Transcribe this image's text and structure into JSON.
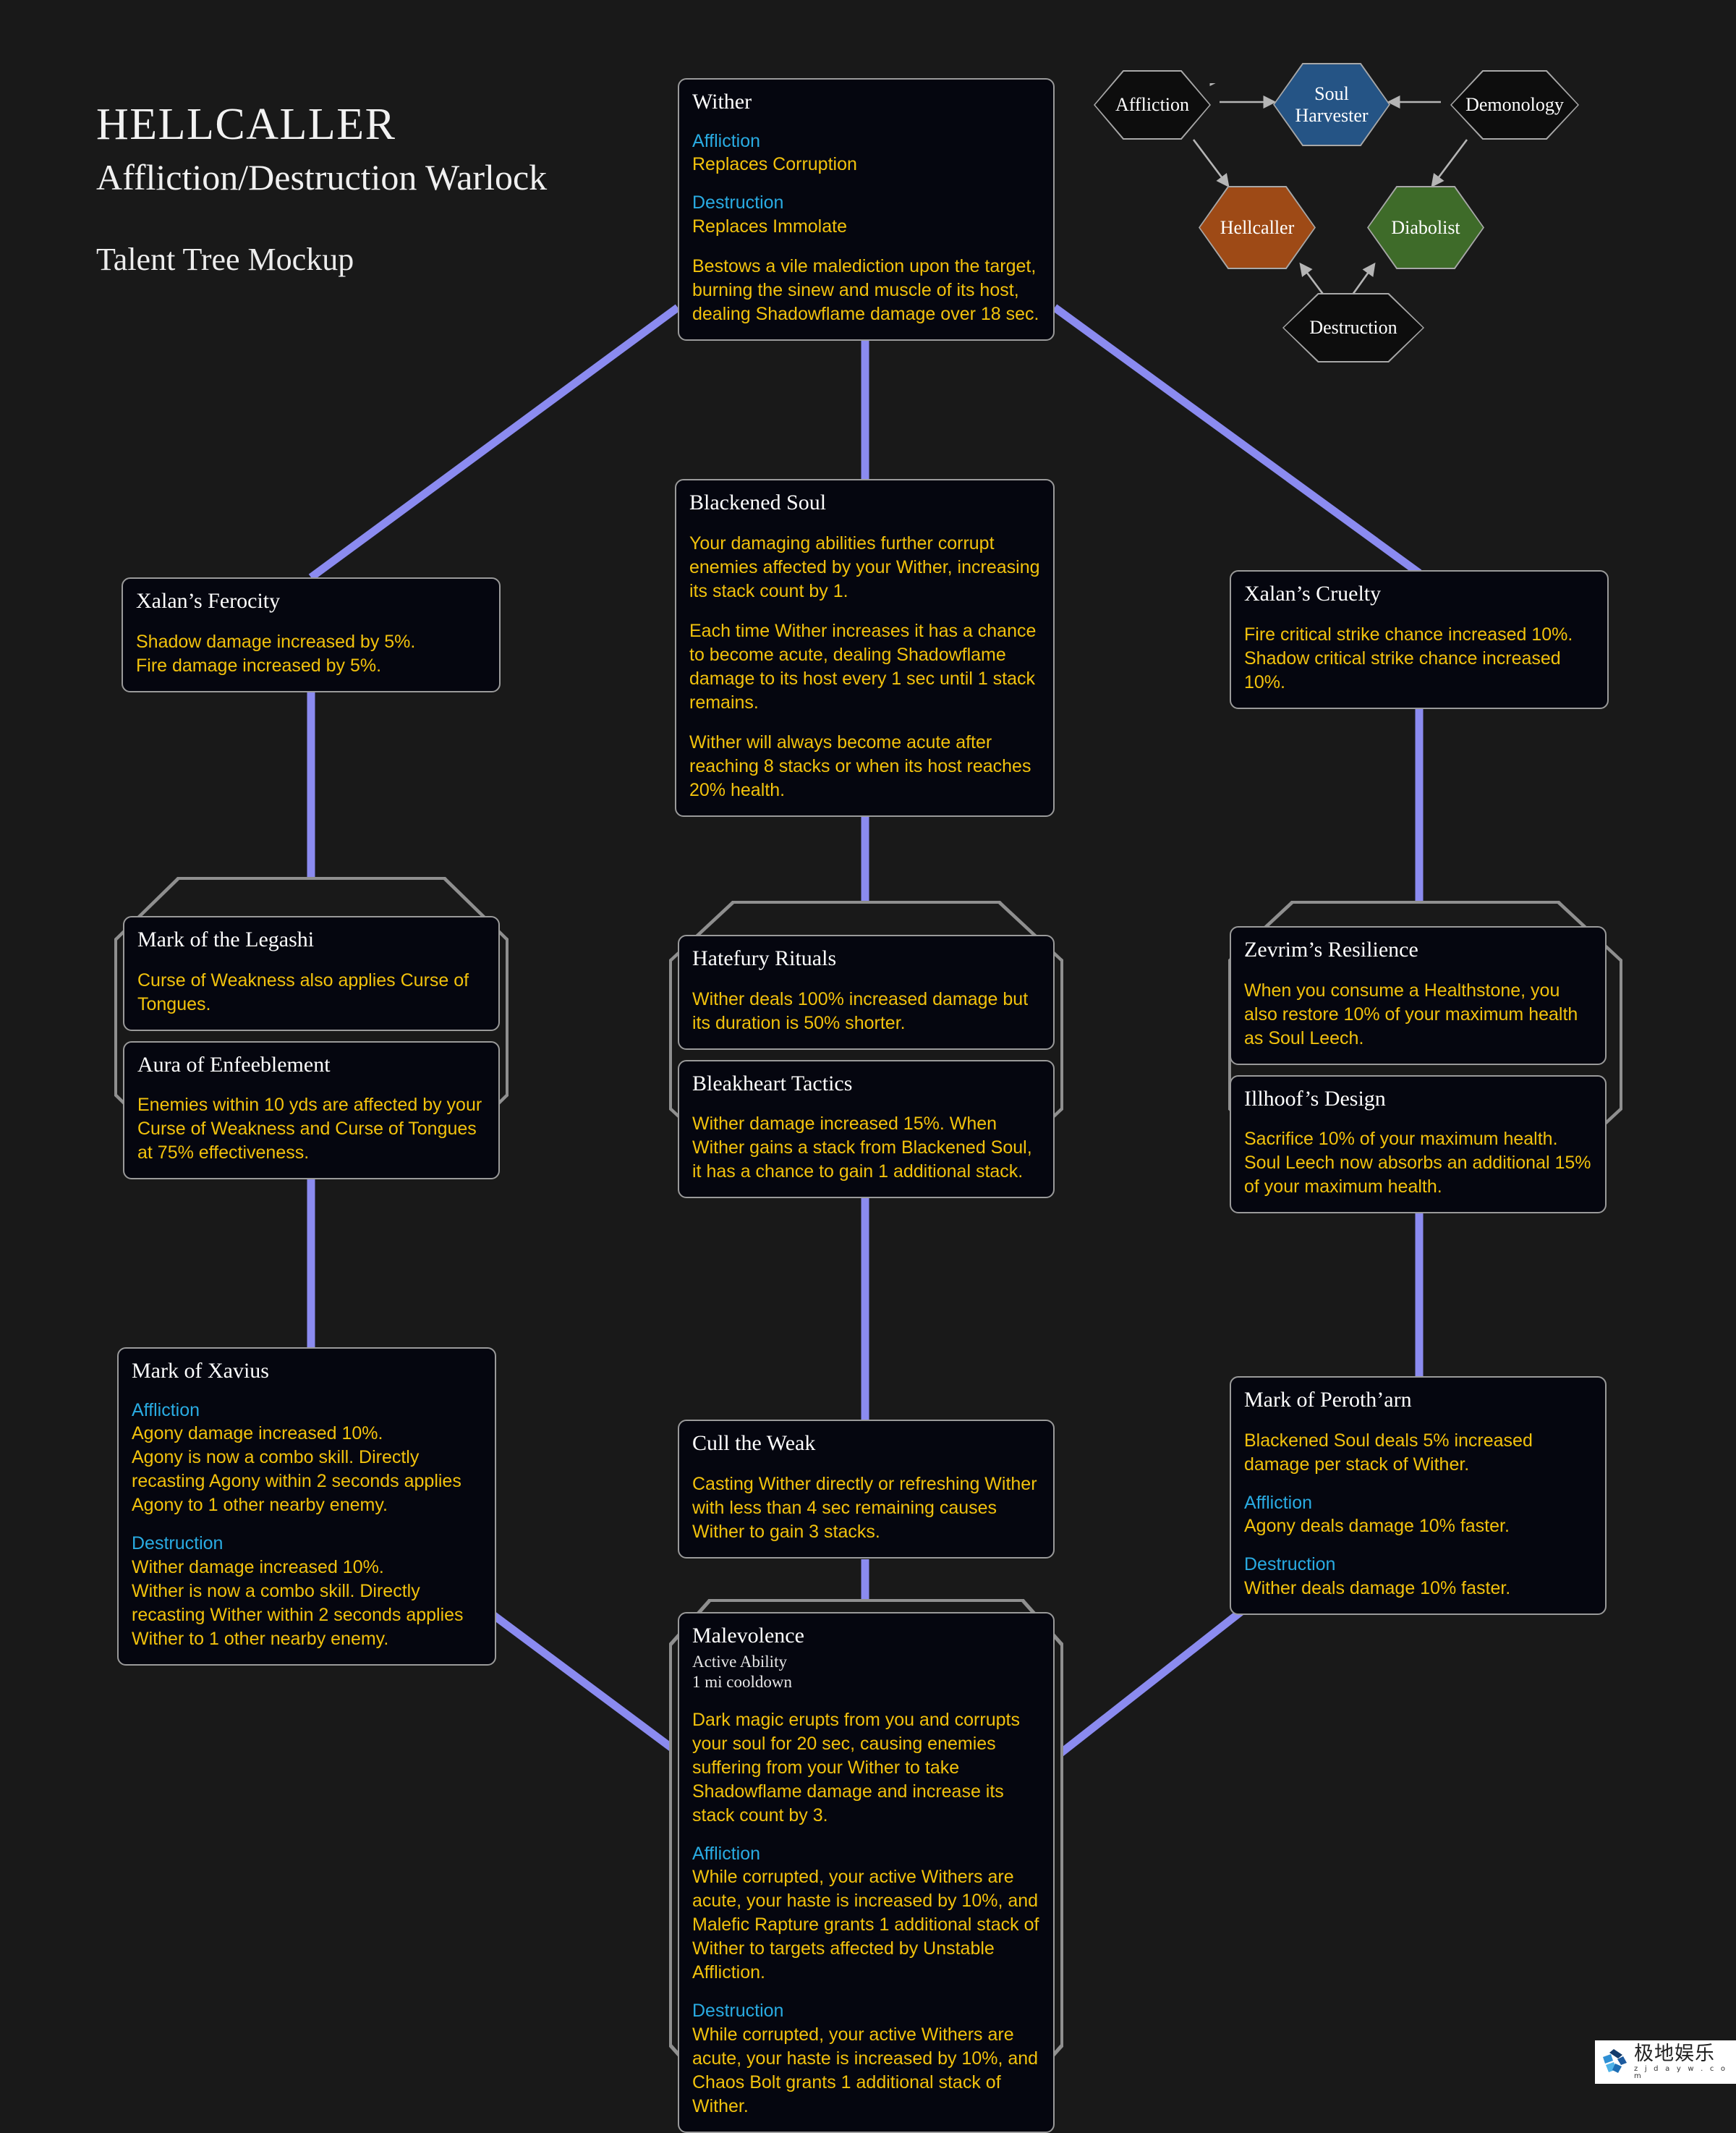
{
  "title": {
    "main": "HELLCALLER",
    "sub": "Affliction/Destruction Warlock",
    "third": "Talent Tree Mockup"
  },
  "colors": {
    "background": "#191919",
    "node_fill": "#05060f",
    "node_border": "#9a9a9a",
    "connector": "#8b8bf0",
    "spec_heading": "#29abe2",
    "description": "#f2c20c",
    "node_title": "#ffffff",
    "hero_soul_harvester": "#255485",
    "hero_hellcaller": "#9e4a16",
    "hero_diabolist": "#3e6b29",
    "hero_spec_fill": "#0d0d0d",
    "hero_outline": "#a8a8a8"
  },
  "hero_tree": {
    "nodes": [
      {
        "id": "affliction",
        "label": "Affliction",
        "kind": "spec"
      },
      {
        "id": "soul-harvester",
        "label": "Soul Harvester",
        "kind": "hero",
        "accent": "#255485"
      },
      {
        "id": "demonology",
        "label": "Demonology",
        "kind": "spec"
      },
      {
        "id": "hellcaller",
        "label": "Hellcaller",
        "kind": "hero",
        "accent": "#9e4a16"
      },
      {
        "id": "diabolist",
        "label": "Diabolist",
        "kind": "hero",
        "accent": "#3e6b29"
      },
      {
        "id": "destruction",
        "label": "Destruction",
        "kind": "spec"
      }
    ],
    "arrows": [
      {
        "from": "affliction",
        "to": "soul-harvester"
      },
      {
        "from": "demonology",
        "to": "soul-harvester"
      },
      {
        "from": "affliction",
        "to": "hellcaller"
      },
      {
        "from": "demonology",
        "to": "diabolist"
      },
      {
        "from": "destruction",
        "to": "hellcaller"
      },
      {
        "from": "destruction",
        "to": "diabolist"
      }
    ]
  },
  "talents": {
    "wither": {
      "name": "Wither",
      "spec_a_label": "Affliction",
      "spec_a_text": "Replaces Corruption",
      "spec_b_label": "Destruction",
      "spec_b_text": "Replaces Immolate",
      "desc": "Bestows a vile malediction upon the target, burning the sinew and muscle of its host, dealing Shadowflame damage over 18 sec."
    },
    "blackened_soul": {
      "name": "Blackened Soul",
      "para1": "Your damaging abilities further corrupt enemies affected by your Wither, increasing its stack count by 1.",
      "para2": "Each time Wither increases it has a chance to become acute, dealing Shadowflame damage to its host every 1 sec until 1 stack remains.",
      "para3": "Wither will always become acute after reaching 8 stacks or when its host reaches 20% health."
    },
    "xalans_ferocity": {
      "name": "Xalan’s Ferocity",
      "desc": "Shadow damage increased by 5%.\nFire damage increased by 5%."
    },
    "xalans_cruelty": {
      "name": "Xalan’s Cruelty",
      "desc": "Fire critical strike chance increased 10%. Shadow critical strike chance increased 10%."
    },
    "mark_of_the_legashi": {
      "name": "Mark of the Legashi",
      "desc": "Curse of Weakness also applies Curse of Tongues."
    },
    "aura_of_enfeeblement": {
      "name": "Aura of Enfeeblement",
      "desc": "Enemies within 10 yds are affected by your Curse of Weakness and Curse of Tongues at 75% effectiveness."
    },
    "hatefury_rituals": {
      "name": "Hatefury Rituals",
      "desc": "Wither deals 100% increased damage but its duration is 50% shorter."
    },
    "bleakheart_tactics": {
      "name": "Bleakheart Tactics",
      "desc": "Wither damage increased 15%. When Wither gains a stack from Blackened Soul, it has a chance to gain 1 additional stack."
    },
    "zevrims_resilience": {
      "name": "Zevrim’s Resilience",
      "desc": "When you consume a Healthstone, you also restore 10% of your maximum health as Soul Leech."
    },
    "illhoofs_design": {
      "name": "Illhoof’s Design",
      "desc": "Sacrifice 10% of your maximum health. Soul Leech now absorbs an additional 15% of your maximum health."
    },
    "mark_of_xavius": {
      "name": "Mark of Xavius",
      "spec_a_label": "Affliction",
      "spec_a_text": "Agony damage increased 10%.\nAgony is now a combo skill. Directly recasting Agony within 2 seconds applies Agony to 1 other nearby enemy.",
      "spec_b_label": "Destruction",
      "spec_b_text": "Wither damage increased 10%.\nWither is now a combo skill. Directly recasting Wither within 2 seconds applies Wither to 1 other nearby enemy."
    },
    "cull_the_weak": {
      "name": "Cull the Weak",
      "desc": "Casting Wither directly or refreshing Wither with less than 4 sec remaining causes Wither to gain 3 stacks."
    },
    "mark_of_perotharn": {
      "name": "Mark of Peroth’arn",
      "desc": "Blackened Soul deals 5% increased damage per stack of Wither.",
      "spec_a_label": "Affliction",
      "spec_a_text": "Agony deals damage 10% faster.",
      "spec_b_label": "Destruction",
      "spec_b_text": "Wither deals damage 10% faster."
    },
    "malevolence": {
      "name": "Malevolence",
      "meta_line1": "Active Ability",
      "meta_line2": "1 mi cooldown",
      "desc": "Dark magic erupts from you and corrupts your soul for 20 sec, causing enemies suffering from your Wither to take Shadowflame damage and increase its stack count by 3.",
      "spec_a_label": "Affliction",
      "spec_a_text": "While corrupted, your active Withers are acute, your haste is increased by 10%, and Malefic Rapture grants 1 additional stack of Wither to targets affected by Unstable Affliction.",
      "spec_b_label": "Destruction",
      "spec_b_text": "While corrupted, your active Withers are acute, your haste is increased by 10%, and Chaos Bolt grants 1 additional stack of Wither."
    }
  },
  "watermark": {
    "cn": "极地娱乐",
    "en": "z j d a y w . c o m"
  }
}
